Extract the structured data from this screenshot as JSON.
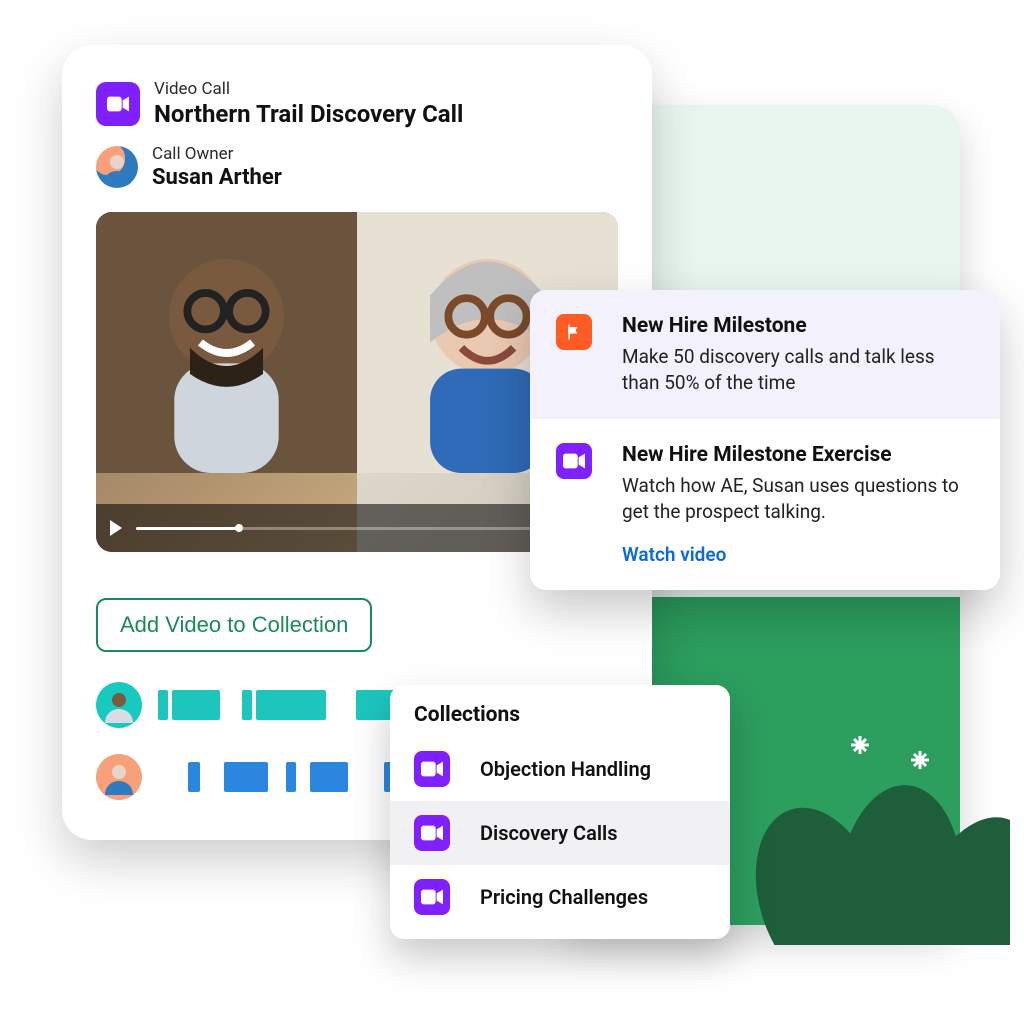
{
  "header": {
    "type_label": "Video Call",
    "title": "Northern Trail Discovery Call"
  },
  "owner": {
    "label": "Call Owner",
    "name": "Susan Arther"
  },
  "video": {
    "progress_pct": 22
  },
  "add_button_label": "Add Video to Collection",
  "collections": {
    "heading": "Collections",
    "items": [
      {
        "label": "Objection Handling",
        "active": false
      },
      {
        "label": "Discovery Calls",
        "active": true
      },
      {
        "label": "Pricing Challenges",
        "active": false
      }
    ]
  },
  "milestones": [
    {
      "icon": "flag-icon",
      "icon_color": "orange",
      "title": "New Hire Milestone",
      "body": "Make 50 discovery calls and talk less than 50% of the time"
    },
    {
      "icon": "video-icon",
      "icon_color": "purple",
      "title": "New Hire Milestone Exercise",
      "body": "Watch how AE, Susan uses questions to get the prospect talking.",
      "link": "Watch video"
    }
  ],
  "colors": {
    "purple": "#8020ff",
    "orange": "#ff5b24",
    "green": "#1a8a5a",
    "link": "#0d6ad4"
  }
}
